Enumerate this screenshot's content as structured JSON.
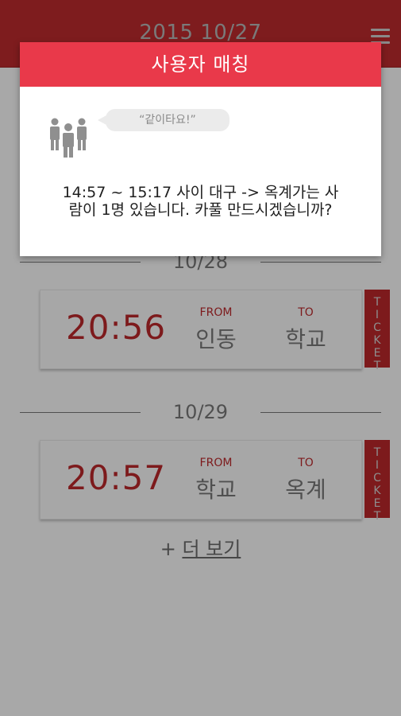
{
  "header": {
    "title": "2015 10/27",
    "menu_icon": "hamburger-menu-icon"
  },
  "dialog": {
    "title": "사용자 매칭",
    "bubble_text": "“같이타요!”",
    "message_line1": "14:57 ~ 15:17 사이 대구 -> 옥계가는 사",
    "message_line2": "람이 1명 있습니다. 카풀 만드시겠습니까?",
    "icon": "people-group-icon",
    "header_color": "#e9394a"
  },
  "sections": [
    {
      "date": "10/28",
      "ride": {
        "time": "20:56",
        "from_caption": "FROM",
        "from": "인동",
        "to_caption": "TO",
        "to": "학교"
      },
      "ticket_label": "TICKET"
    },
    {
      "date": "10/29",
      "ride": {
        "time": "20:57",
        "from_caption": "FROM",
        "from": "학교",
        "to_caption": "TO",
        "to": "옥계"
      },
      "ticket_label": "TICKET"
    }
  ],
  "more": {
    "prefix": "+",
    "label": "더 보기"
  },
  "colors": {
    "brand_red": "#e9394a",
    "dark_red": "#7d1a1c",
    "overlay": "#a8a8a8"
  }
}
